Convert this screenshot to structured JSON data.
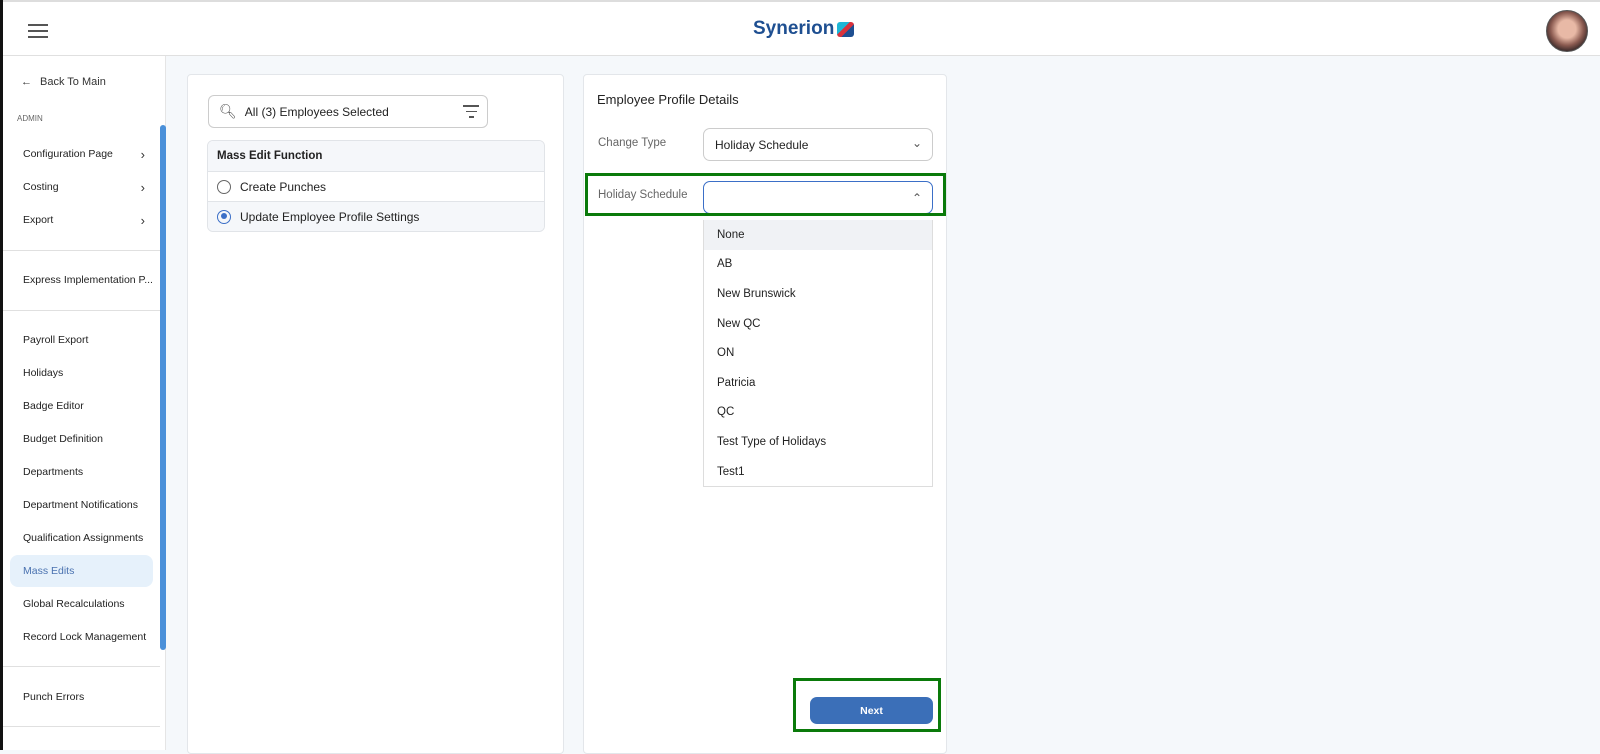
{
  "header": {
    "logo": "Synerion",
    "menu_icon": "hamburger-icon"
  },
  "sidebar": {
    "back": "Back To Main",
    "section": "ADMIN",
    "groups": [
      {
        "label": "Configuration Page"
      },
      {
        "label": "Costing"
      },
      {
        "label": "Export"
      }
    ],
    "express": "Express Implementation P...",
    "items": [
      "Payroll Export",
      "Holidays",
      "Badge Editor",
      "Budget Definition",
      "Departments",
      "Department Notifications",
      "Qualification Assignments",
      "Mass Edits",
      "Global Recalculations",
      "Record Lock Management"
    ],
    "active": "Mass Edits",
    "bottom": "Punch Errors"
  },
  "left_panel": {
    "search_value": "All (3) Employees Selected",
    "function_header": "Mass Edit Function",
    "options": [
      "Create Punches",
      "Update Employee Profile Settings"
    ],
    "selected": "Update Employee Profile Settings"
  },
  "right_panel": {
    "title": "Employee Profile Details",
    "change_type_label": "Change Type",
    "change_type_value": "Holiday Schedule",
    "holiday_label": "Holiday Schedule",
    "holiday_value": "",
    "holiday_options": [
      "None",
      "AB",
      "New Brunswick",
      "New QC",
      "ON",
      "Patricia",
      "QC",
      "Test Type of Holidays",
      "Test1"
    ],
    "next": "Next"
  },
  "colors": {
    "accent": "#3b6fb8",
    "highlight": "#0a7a0a",
    "active_bg": "#e6f1fb"
  }
}
